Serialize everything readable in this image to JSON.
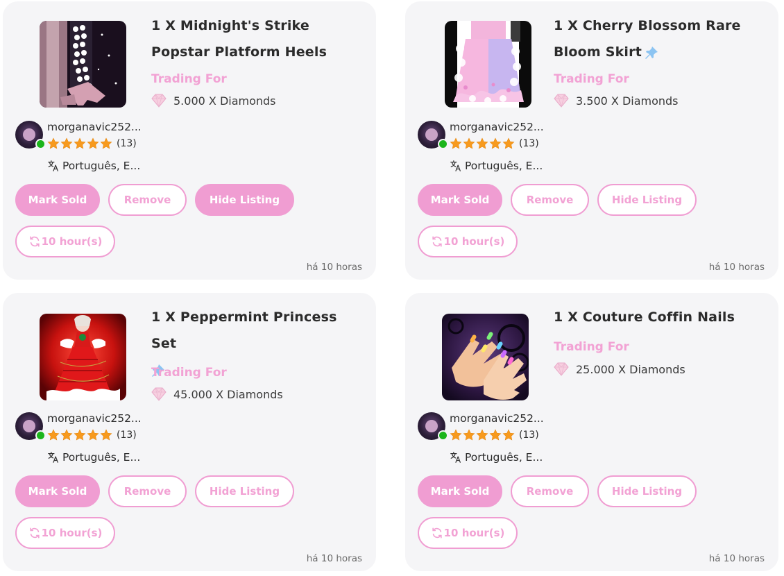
{
  "colors": {
    "accent": "#f09dd2",
    "trading_label": "#f2a2d4",
    "online": "#1bb51b",
    "star": "#f79a1e"
  },
  "seller": {
    "username": "morganavic252...",
    "rating_count": "(13)",
    "stars": 5,
    "language": "Português, E...",
    "online": true
  },
  "buttons": {
    "mark_sold": "Mark Sold",
    "remove": "Remove",
    "hide_listing": "Hide Listing",
    "duration": "10 hour(s)"
  },
  "listings": [
    {
      "title": "1 X Midnight's Strike Popstar Platform Heels",
      "pinned": false,
      "trading_label": "Trading For",
      "price": "5.000 X Diamonds",
      "posted": "há 10 horas",
      "hide_listing_active": true,
      "image_icon": "platform-heels-image"
    },
    {
      "title": "1 X Cherry Blossom Rare Bloom Skirt",
      "pinned": true,
      "trading_label": "Trading For",
      "price": "3.500 X Diamonds",
      "posted": "há 10 horas",
      "hide_listing_active": false,
      "image_icon": "bloom-skirt-image"
    },
    {
      "title": "1 X Peppermint Princess Set",
      "pinned": true,
      "trading_label": "Trading For",
      "price": "45.000 X Diamonds",
      "posted": "há 10 horas",
      "hide_listing_active": false,
      "image_icon": "princess-dress-image"
    },
    {
      "title": "1 X Couture Coffin Nails",
      "pinned": false,
      "trading_label": "Trading For",
      "price": "25.000 X Diamonds",
      "posted": "há 10 horas",
      "hide_listing_active": false,
      "image_icon": "coffin-nails-image"
    }
  ]
}
